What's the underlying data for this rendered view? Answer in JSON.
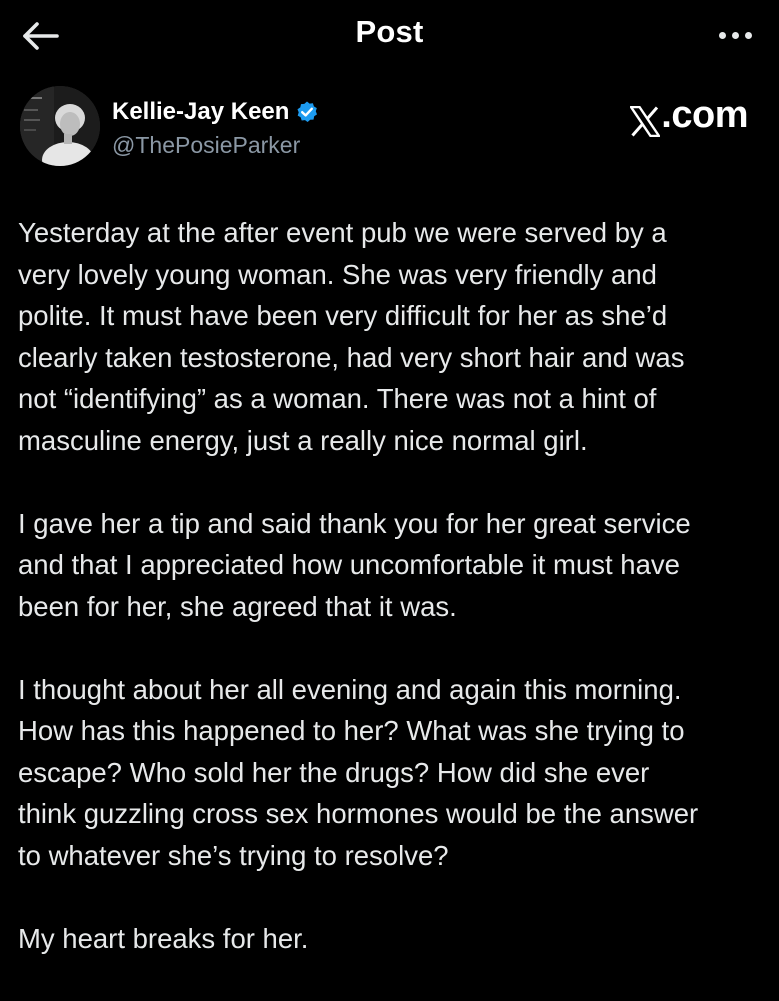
{
  "header": {
    "title": "Post",
    "back_icon": "arrow-left-icon",
    "more_icon": "more-horizontal-icon"
  },
  "author": {
    "name": "Kellie-Jay Keen",
    "handle": "@ThePosieParker",
    "verified": true,
    "verified_color": "#1d9bf0"
  },
  "watermark": {
    "text": ".com",
    "logo_icon": "x-logo-icon"
  },
  "post": {
    "paragraphs": [
      "Yesterday at the after event pub we were served by a\nvery lovely young woman.  She was very friendly and\npolite.  It must have been very difficult for her as she’d\nclearly taken testosterone, had very short hair and was\nnot “identifying” as a woman. There was not a hint of\nmasculine energy, just a really nice normal girl.",
      "I gave her a tip and said thank you for her great service\nand that I appreciated how uncomfortable it must have\nbeen for her, she agreed that it was.",
      "I thought about her all evening and again this morning.\nHow has this happened to her?   What was she trying to\nescape?  Who sold her the drugs?  How did she ever\nthink guzzling cross sex hormones would be the answer\nto whatever she’s trying to resolve?",
      "My heart breaks for her."
    ]
  },
  "colors": {
    "background": "#000000",
    "text": "#e7e9ea",
    "secondary_text": "#8b98a5",
    "accent": "#1d9bf0"
  }
}
